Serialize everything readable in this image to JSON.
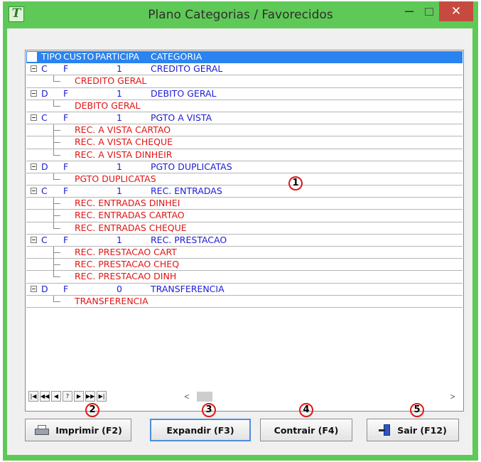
{
  "window": {
    "title": "Plano Categorias / Favorecidos",
    "app_icon_glyph": "T",
    "minimize_glyph": "–",
    "maximize_glyph": "",
    "close_glyph": "✕",
    "titlebar_color": "#5fc957",
    "close_color": "#c74a40"
  },
  "grid": {
    "columns": [
      "TIPO",
      "CUSTO",
      "PARTICIPA",
      "CATEGORIA"
    ],
    "groups": [
      {
        "tipo": "C",
        "custo": "F",
        "participa": "1",
        "categoria": "CREDITO GERAL",
        "children": [
          "CREDITO GERAL"
        ]
      },
      {
        "tipo": "D",
        "custo": "F",
        "participa": "1",
        "categoria": "DEBITO GERAL",
        "children": [
          "DEBITO GERAL"
        ]
      },
      {
        "tipo": "C",
        "custo": "F",
        "participa": "1",
        "categoria": "PGTO A VISTA",
        "children": [
          "REC. A VISTA CARTAO",
          "REC. A VISTA CHEQUE",
          "REC. A VISTA DINHEIR"
        ]
      },
      {
        "tipo": "D",
        "custo": "F",
        "participa": "1",
        "categoria": "PGTO DUPLICATAS",
        "children": [
          "PGTO DUPLICATAS"
        ]
      },
      {
        "tipo": "C",
        "custo": "F",
        "participa": "1",
        "categoria": "REC. ENTRADAS",
        "children": [
          "REC. ENTRADAS DINHEI",
          "REC. ENTRADAS CARTAO",
          "REC. ENTRADAS CHEQUE"
        ]
      },
      {
        "tipo": "C",
        "custo": "F",
        "participa": "1",
        "categoria": "REC. PRESTACAO",
        "children": [
          "REC. PRESTACAO CART",
          "REC. PRESTACAO CHEQ",
          "REC. PRESTACAO DINH"
        ]
      },
      {
        "tipo": "D",
        "custo": "F",
        "participa": "0",
        "categoria": "TRANSFERENCIA",
        "children": [
          "TRANSFERENCIA"
        ]
      }
    ],
    "parent_color": "#1c1cd8",
    "child_color": "#e21414",
    "header_color": "#2a83ee"
  },
  "navigator": {
    "buttons": [
      {
        "name": "first-record-button",
        "glyph": "|◀"
      },
      {
        "name": "prior-page-button",
        "glyph": "◀◀"
      },
      {
        "name": "prior-record-button",
        "glyph": "◀"
      },
      {
        "name": "help-button",
        "glyph": "?"
      },
      {
        "name": "next-record-button",
        "glyph": "▶"
      },
      {
        "name": "next-page-button",
        "glyph": "▶▶"
      },
      {
        "name": "last-record-button",
        "glyph": "▶|"
      }
    ],
    "scroll_left_glyph": "<",
    "scroll_right_glyph": ">"
  },
  "buttons": {
    "print": "Imprimir (F2)",
    "expand": "Expandir (F3)",
    "collapse": "Contrair (F4)",
    "exit": "Sair (F12)"
  },
  "callouts": [
    "1",
    "2",
    "3",
    "4",
    "5"
  ]
}
